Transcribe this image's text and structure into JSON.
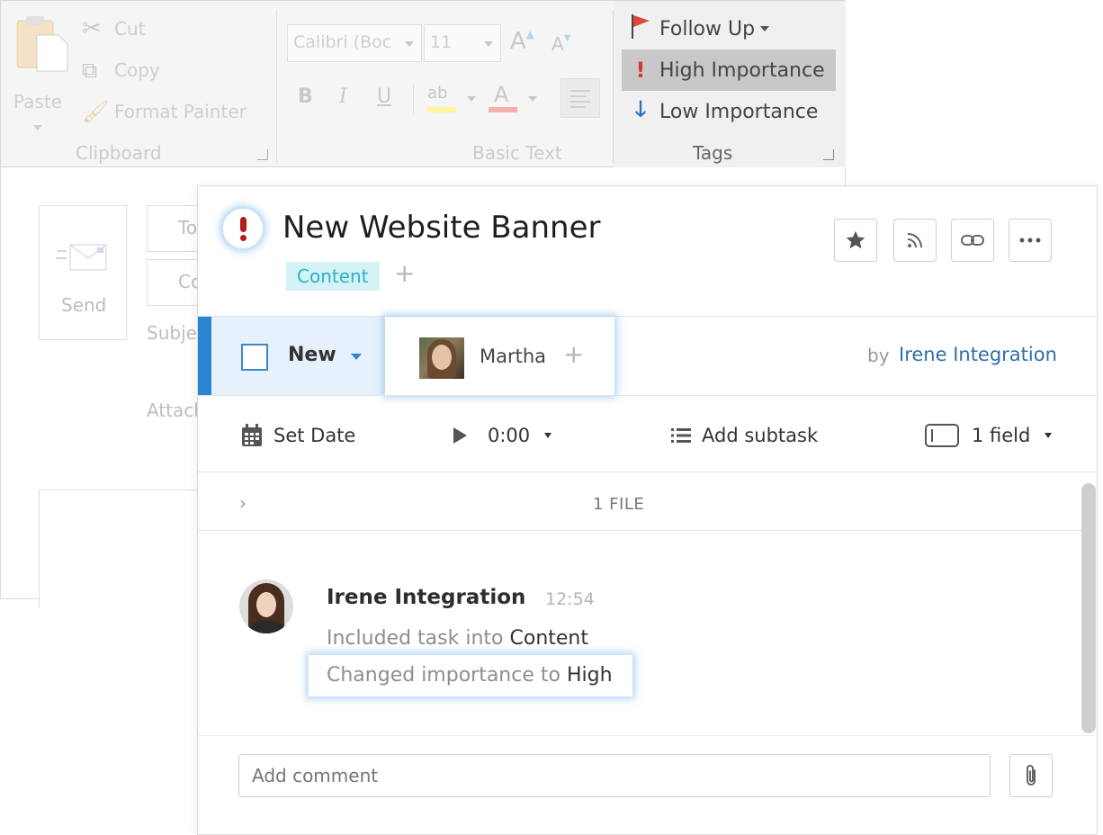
{
  "ribbon": {
    "clipboard": {
      "paste_label": "Paste",
      "cut_label": "Cut",
      "copy_label": "Copy",
      "format_painter_label": "Format Painter",
      "group_title": "Clipboard"
    },
    "basic_text": {
      "font_name": "Calibri (Boc",
      "font_size": "11",
      "bold": "B",
      "italic": "I",
      "underline": "U",
      "grow_font": "A",
      "shrink_font": "A",
      "highlight_glyph": "ab",
      "font_color_glyph": "A",
      "group_title": "Basic Text"
    },
    "tags": {
      "follow_up_label": "Follow Up",
      "high_importance_label": "High Importance",
      "low_importance_label": "Low Importance",
      "group_title": "Tags"
    }
  },
  "compose": {
    "send_label": "Send",
    "to_label": "To",
    "cc_label": "Cc",
    "subject_label": "Subje",
    "attach_label": "Attach"
  },
  "task": {
    "title": "New Website Banner",
    "tag": "Content",
    "status": "New",
    "assignee": "Martha",
    "by_label": "by",
    "author": "Irene Integration",
    "set_date_label": "Set Date",
    "timer_value": "0:00",
    "add_subtask_label": "Add subtask",
    "fields_label": "1 field",
    "file_count_label": "1 FILE"
  },
  "activity": {
    "author": "Irene Integration",
    "time": "12:54",
    "line1_prefix": "Included task into",
    "line1_value": "Content",
    "line2_prefix": "Changed importance to",
    "line2_value": "High"
  },
  "comment": {
    "placeholder": "Add comment"
  },
  "colors": {
    "accent_blue": "#2c84d3",
    "importance_red": "#b01e1e",
    "tag_cyan": "#2bb3c4",
    "link_blue": "#2d6fa8"
  }
}
